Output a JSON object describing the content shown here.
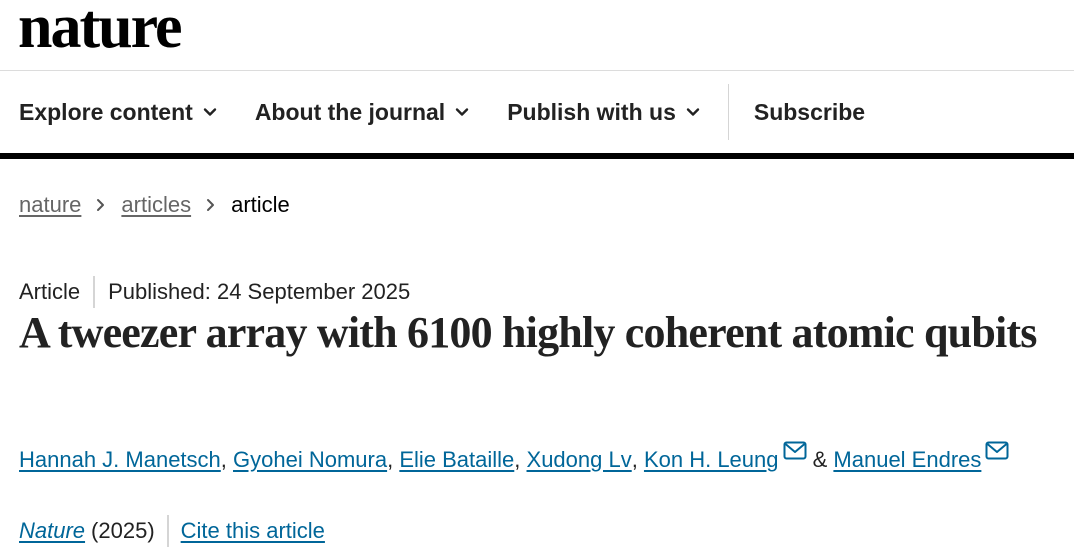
{
  "site": {
    "logo": "nature"
  },
  "nav": {
    "items": [
      {
        "label": "Explore content",
        "has_dropdown": true
      },
      {
        "label": "About the journal",
        "has_dropdown": true
      },
      {
        "label": "Publish with us",
        "has_dropdown": true
      }
    ],
    "subscribe_label": "Subscribe"
  },
  "breadcrumb": {
    "items": [
      "nature",
      "articles"
    ],
    "current": "article"
  },
  "article": {
    "type": "Article",
    "published": "Published: 24 September 2025",
    "title": "A tweezer array with 6100 highly coherent atomic qubits",
    "authors": [
      {
        "name": "Hannah J. Manetsch",
        "separator": ", "
      },
      {
        "name": "Gyohei Nomura",
        "separator": ", "
      },
      {
        "name": "Elie Bataille",
        "separator": ", "
      },
      {
        "name": "Xudong Lv",
        "separator": ", "
      },
      {
        "name": "Kon H. Leung",
        "separator": " & "
      },
      {
        "name": "Manuel Endres",
        "separator": ""
      }
    ],
    "journal": "Nature",
    "year": "(2025)",
    "cite_label": "Cite this article"
  },
  "colors": {
    "link": "#006699",
    "text": "#222222",
    "divider": "#d5d5d5"
  },
  "icons": {
    "nav_dropdown": "chevron-down-icon",
    "breadcrumb_separator": "chevron-right-icon",
    "author_contact": "mail-icon"
  }
}
